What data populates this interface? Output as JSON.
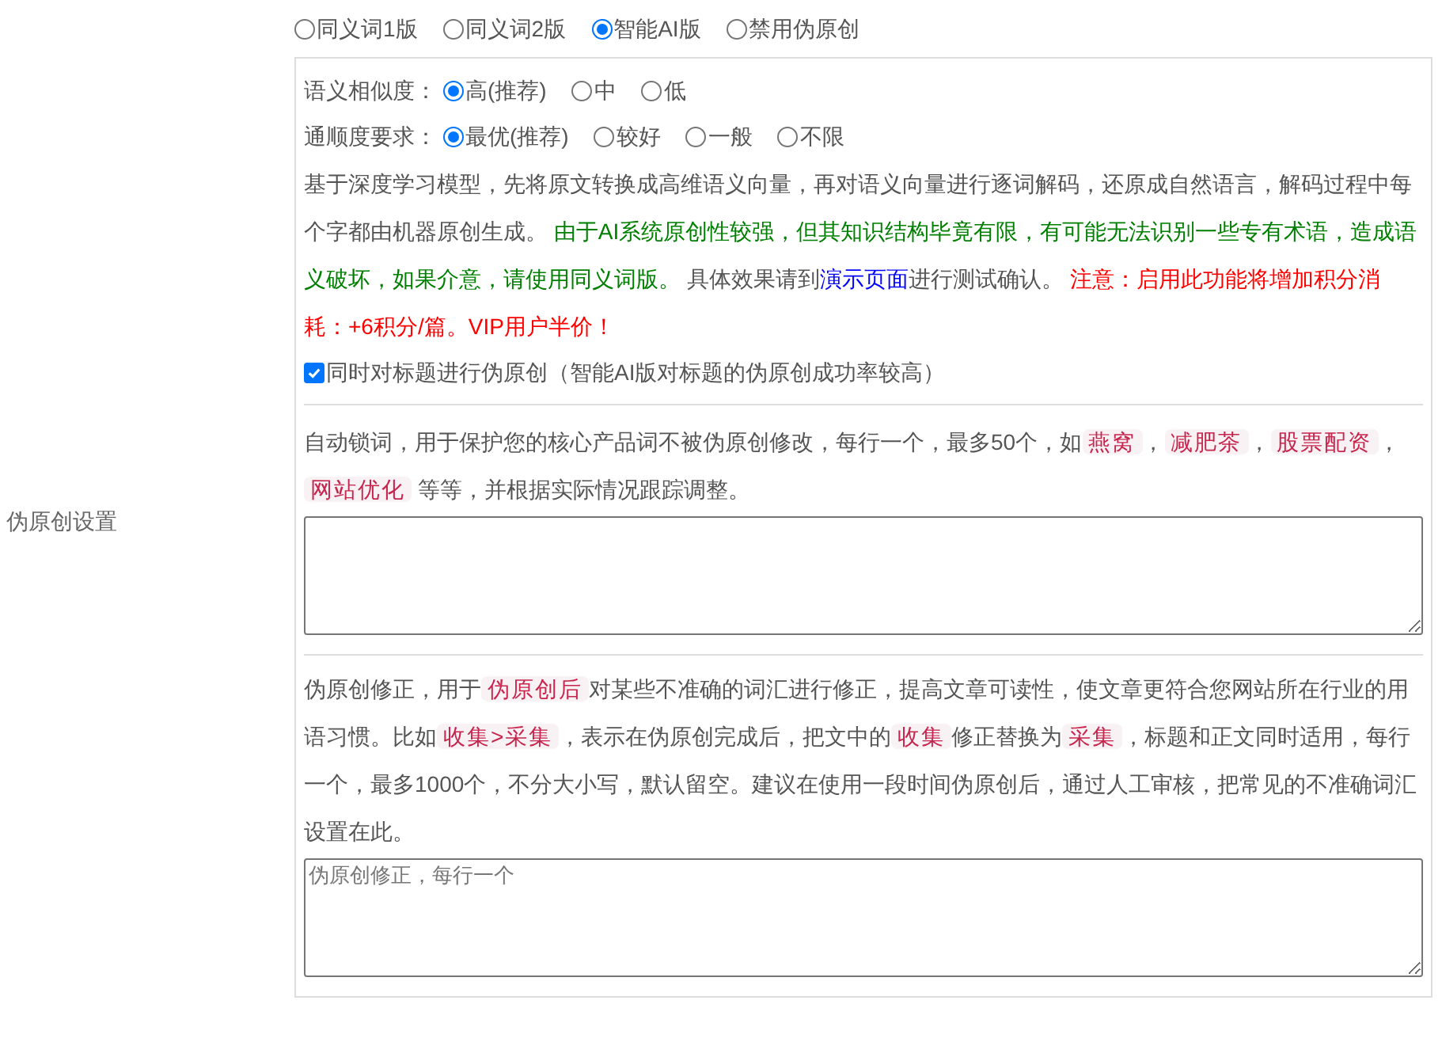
{
  "section_label": "伪原创设置",
  "modes": [
    {
      "label": "同义词1版",
      "selected": false
    },
    {
      "label": "同义词2版",
      "selected": false
    },
    {
      "label": "智能AI版",
      "selected": true
    },
    {
      "label": "禁用伪原创",
      "selected": false
    }
  ],
  "similarity": {
    "label": "语义相似度：",
    "options": [
      {
        "label": "高(推荐)",
        "selected": true
      },
      {
        "label": "中",
        "selected": false
      },
      {
        "label": "低",
        "selected": false
      }
    ]
  },
  "fluency": {
    "label": "通顺度要求：",
    "options": [
      {
        "label": "最优(推荐)",
        "selected": true
      },
      {
        "label": "较好",
        "selected": false
      },
      {
        "label": "一般",
        "selected": false
      },
      {
        "label": "不限",
        "selected": false
      }
    ]
  },
  "ai_description": [
    {
      "kind": "plain",
      "text": "基于深度学习模型，先将原文转换成高维语义向量，再对语义向量进行逐词解码，还原成自然语言，解码过程中每个字都由机器原创生成。 "
    },
    {
      "kind": "green",
      "text": "由于AI系统原创性较强，但其知识结构毕竟有限，有可能无法识别一些专有术语，造成语义破坏，如果介意，请使用同义词版。"
    },
    {
      "kind": "plain",
      "text": " 具体效果请到"
    },
    {
      "kind": "link",
      "text": "演示页面"
    },
    {
      "kind": "plain",
      "text": "进行测试确认。 "
    },
    {
      "kind": "red",
      "text": "注意：启用此功能将增加积分消耗：+6积分/篇。VIP用户半价！"
    }
  ],
  "title_option": {
    "label": "同时对标题进行伪原创（智能AI版对标题的伪原创成功率较高）",
    "checked": true
  },
  "lock_words": {
    "description": [
      {
        "kind": "plain",
        "text": "自动锁词，用于保护您的核心产品词不被伪原创修改，每行一个，最多50个，如"
      },
      {
        "kind": "tag",
        "text": "燕窝"
      },
      {
        "kind": "plain",
        "text": "，"
      },
      {
        "kind": "tag",
        "text": "减肥茶"
      },
      {
        "kind": "plain",
        "text": "，"
      },
      {
        "kind": "tag",
        "text": "股票配资"
      },
      {
        "kind": "plain",
        "text": "，"
      },
      {
        "kind": "tag",
        "text": "网站优化"
      },
      {
        "kind": "plain",
        "text": " 等等，并根据实际情况跟踪调整。"
      }
    ]
  },
  "corrections": {
    "description": [
      {
        "kind": "plain",
        "text": "伪原创修正，用于"
      },
      {
        "kind": "tag",
        "text": "伪原创后"
      },
      {
        "kind": "plain",
        "text": "对某些不准确的词汇进行修正，提高文章可读性，使文章更符合您网站所在行业的用语习惯。比如"
      },
      {
        "kind": "tag",
        "text": "收集>采集"
      },
      {
        "kind": "plain",
        "text": "，表示在伪原创完成后，把文中的"
      },
      {
        "kind": "tag",
        "text": "收集"
      },
      {
        "kind": "plain",
        "text": "修正替换为"
      },
      {
        "kind": "tag",
        "text": "采集"
      },
      {
        "kind": "plain",
        "text": "，标题和正文同时适用，每行一个，最多1000个，不分大小写，默认留空。建议在使用一段时间伪原创后，通过人工审核，把常见的不准确词汇设置在此。"
      }
    ],
    "placeholder": "伪原创修正，每行一个"
  }
}
